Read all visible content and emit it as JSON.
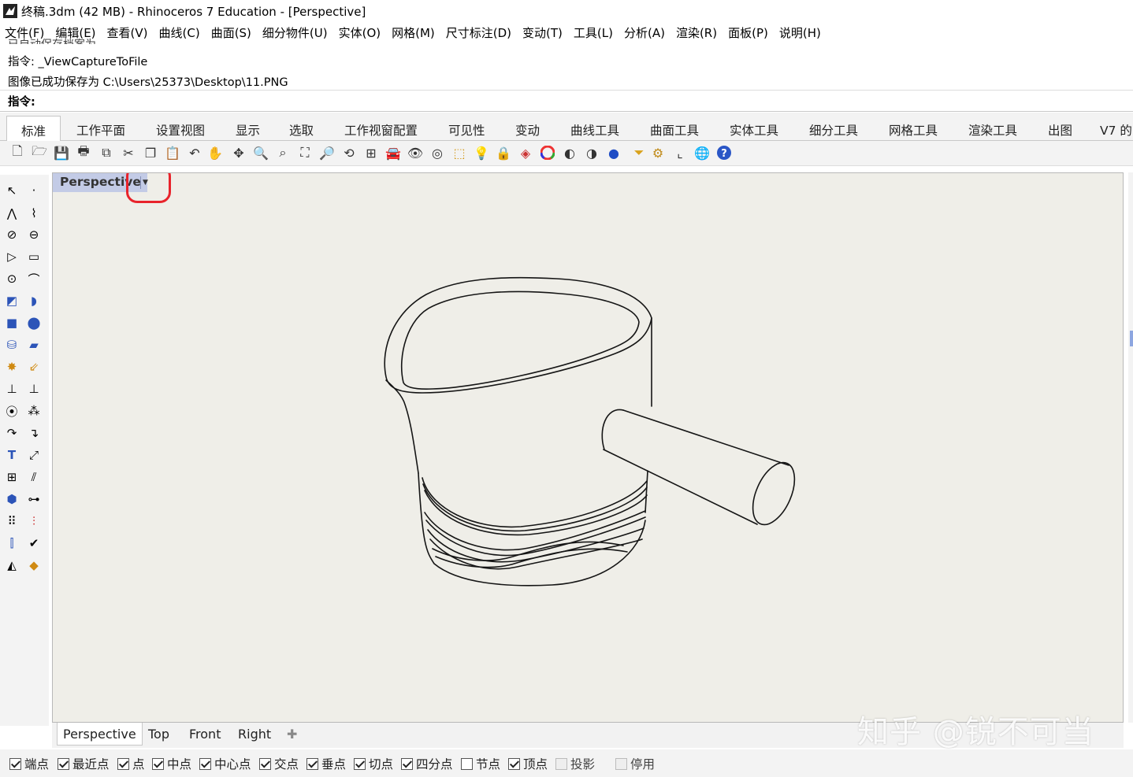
{
  "window": {
    "title": "终稿.3dm (42 MB) - Rhinoceros 7 Education - [Perspective]"
  },
  "menu": [
    "文件(F)",
    "编辑(E)",
    "查看(V)",
    "曲线(C)",
    "曲面(S)",
    "细分物件(U)",
    "实体(O)",
    "网格(M)",
    "尺寸标注(D)",
    "变动(T)",
    "工具(L)",
    "分析(A)",
    "渲染(R)",
    "面板(P)",
    "说明(H)"
  ],
  "command": {
    "partial_line": "已自动保存档案为...",
    "history": [
      "指令: _ViewCaptureToFile",
      "图像已成功保存为 C:\\Users\\25373\\Desktop\\11.PNG"
    ],
    "prompt": "指令:",
    "input_value": ""
  },
  "tabs": [
    "标准",
    "工作平面",
    "设置视图",
    "显示",
    "选取",
    "工作视窗配置",
    "可见性",
    "变动",
    "曲线工具",
    "曲面工具",
    "实体工具",
    "细分工具",
    "网格工具",
    "渲染工具",
    "出图",
    "V7 的"
  ],
  "toolbar_icons": [
    "new-icon",
    "open-icon",
    "save-icon",
    "print-icon",
    "import-icon",
    "cut-icon",
    "copy-icon",
    "paste-icon",
    "undo-icon",
    "pan-icon",
    "rotate-view-icon",
    "zoom-icon",
    "zoom-window-icon",
    "zoom-extents-icon",
    "zoom-selected-icon",
    "undo-view-icon",
    "four-viewports-icon",
    "car-icon",
    "hide-icon",
    "layer-icon",
    "select-icon",
    "light-icon",
    "lock-icon",
    "material-icon",
    "color-wheel-icon",
    "shade-icon",
    "rendered-icon",
    "render-sphere-icon",
    "filter-icon",
    "options-icon",
    "dimension-icon",
    "globe-icon",
    "help-icon"
  ],
  "left_tools": [
    "select-arrow-icon",
    "point-icon",
    "polyline-icon",
    "curve-points-icon",
    "circle-icon",
    "ellipse-icon",
    "polygon-icon",
    "rectangle-icon",
    "arc-icon",
    "fillet-curve-icon",
    "surface-corners-icon",
    "extrude-surface-icon",
    "box-icon",
    "sphere-icon",
    "cylinder-icon",
    "mesh-plane-icon",
    "gear-transform-icon",
    "arrow-transform-icon",
    "trim-icon",
    "split-icon",
    "boolean-union-icon",
    "boolean-split-icon",
    "fillet-icon",
    "chamfer-icon",
    "text-icon",
    "scale-icon",
    "group-icon",
    "explode-icon",
    "block-icon",
    "dimension-icon",
    "array-icon",
    "align-icon",
    "history-icon",
    "check-icon",
    "mesh-tools-icon",
    "render-material-icon"
  ],
  "viewport": {
    "title": "Perspective",
    "dropdown_icon": "chevron-down-icon"
  },
  "view_tabs": [
    "Perspective",
    "Top",
    "Front",
    "Right"
  ],
  "osnaps": [
    {
      "label": "端点",
      "checked": true
    },
    {
      "label": "最近点",
      "checked": true
    },
    {
      "label": "点",
      "checked": true
    },
    {
      "label": "中点",
      "checked": true
    },
    {
      "label": "中心点",
      "checked": true
    },
    {
      "label": "交点",
      "checked": true
    },
    {
      "label": "垂点",
      "checked": true
    },
    {
      "label": "切点",
      "checked": true
    },
    {
      "label": "四分点",
      "checked": true
    },
    {
      "label": "节点",
      "checked": false
    },
    {
      "label": "顶点",
      "checked": true
    },
    {
      "label": "投影",
      "checked": false,
      "disabled": true
    },
    {
      "label": "停用",
      "checked": false,
      "disabled": true
    }
  ],
  "watermark": "知乎 @锐不可当",
  "colors": {
    "viewport_bg": "#efeee8",
    "viewport_title_bg": "#c3cbe6",
    "highlight": "#e8232b"
  }
}
